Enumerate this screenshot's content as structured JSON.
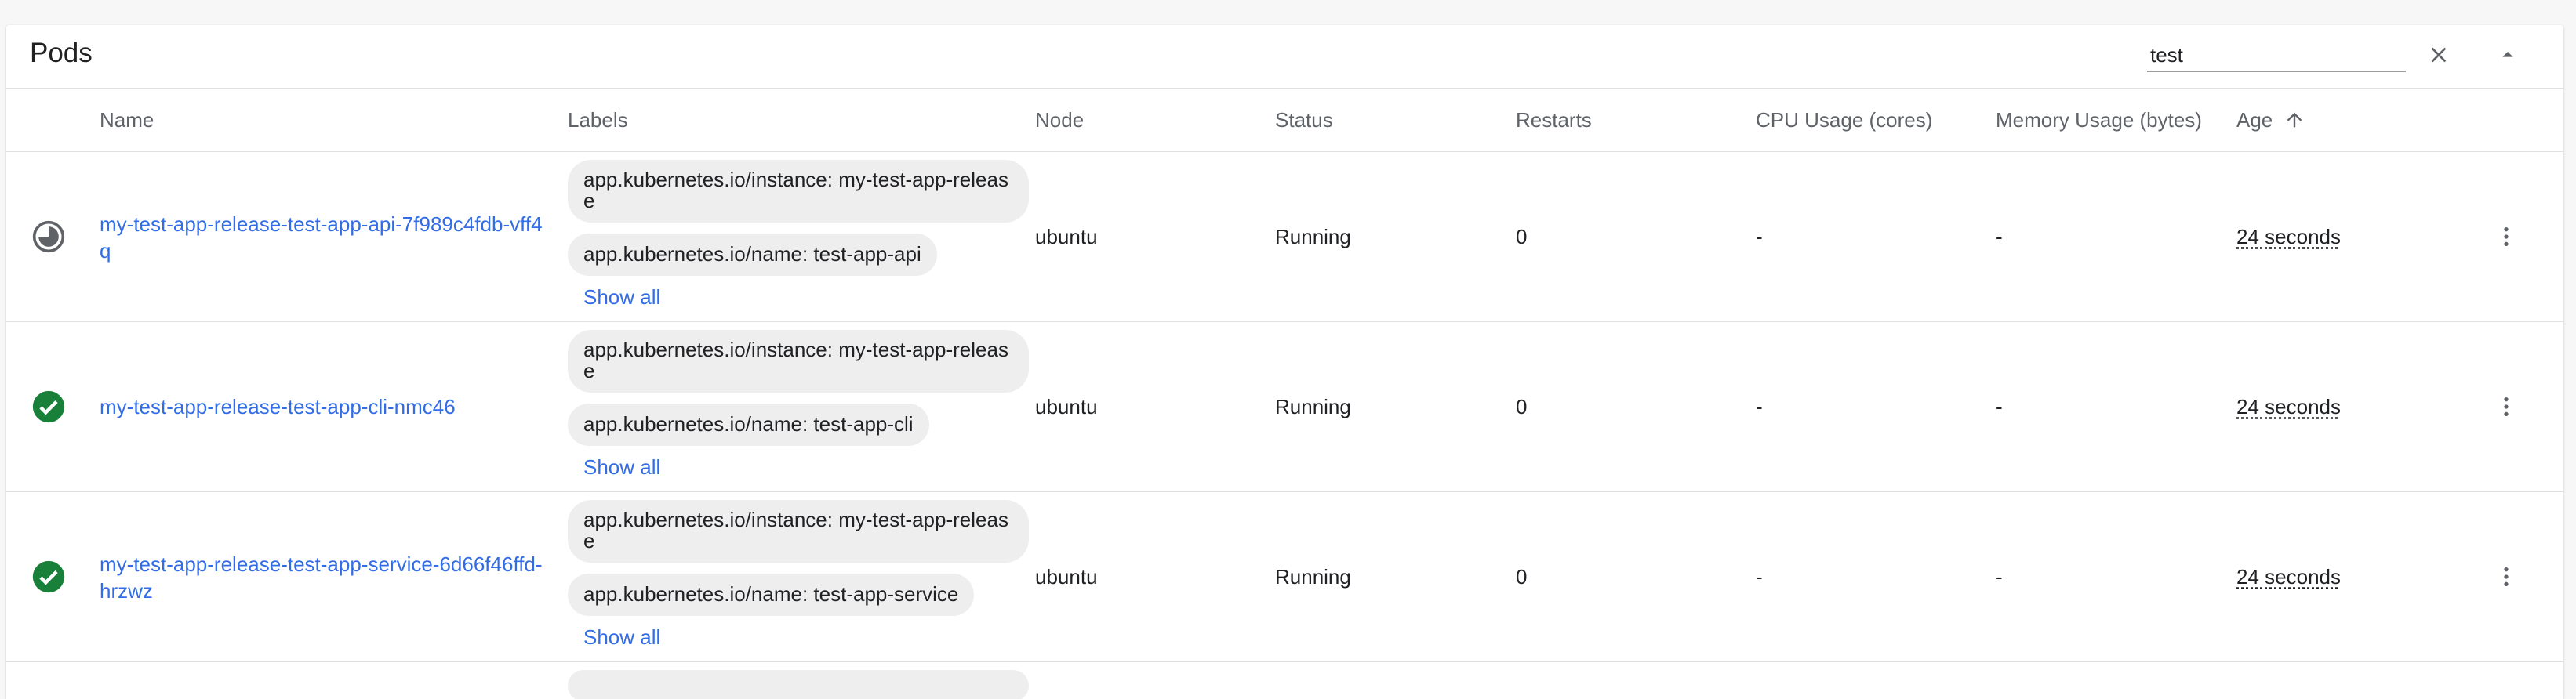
{
  "card": {
    "title": "Pods",
    "search": {
      "value": "test",
      "placeholder": ""
    }
  },
  "columns": [
    "Name",
    "Labels",
    "Node",
    "Status",
    "Restarts",
    "CPU Usage (cores)",
    "Memory Usage (bytes)",
    "Age"
  ],
  "sort": {
    "column": "Age",
    "direction": "ascending",
    "icon": "arrow-up-icon"
  },
  "rows": [
    {
      "status_icon": "pending-icon",
      "name": "my-test-app-release-test-app-api-7f989c4fdb-vff4q",
      "labels": [
        "app.kubernetes.io/instance: my-test-app-release",
        "app.kubernetes.io/name: test-app-api"
      ],
      "show_all": "Show all",
      "node": "ubuntu",
      "status": "Running",
      "restarts": "0",
      "cpu": "-",
      "memory": "-",
      "age": "24 seconds"
    },
    {
      "status_icon": "check-circle-icon",
      "name": "my-test-app-release-test-app-cli-nmc46",
      "labels": [
        "app.kubernetes.io/instance: my-test-app-release",
        "app.kubernetes.io/name: test-app-cli"
      ],
      "show_all": "Show all",
      "node": "ubuntu",
      "status": "Running",
      "restarts": "0",
      "cpu": "-",
      "memory": "-",
      "age": "24 seconds"
    },
    {
      "status_icon": "check-circle-icon",
      "name": "my-test-app-release-test-app-service-6d66f46ffd-hrzwz",
      "labels": [
        "app.kubernetes.io/instance: my-test-app-release",
        "app.kubernetes.io/name: test-app-service"
      ],
      "show_all": "Show all",
      "node": "ubuntu",
      "status": "Running",
      "restarts": "0",
      "cpu": "-",
      "memory": "-",
      "age": "24 seconds"
    }
  ],
  "colors": {
    "link": "#326de6",
    "success": "#188038",
    "pending": "#5f6368",
    "chip": "#eeeeee"
  }
}
